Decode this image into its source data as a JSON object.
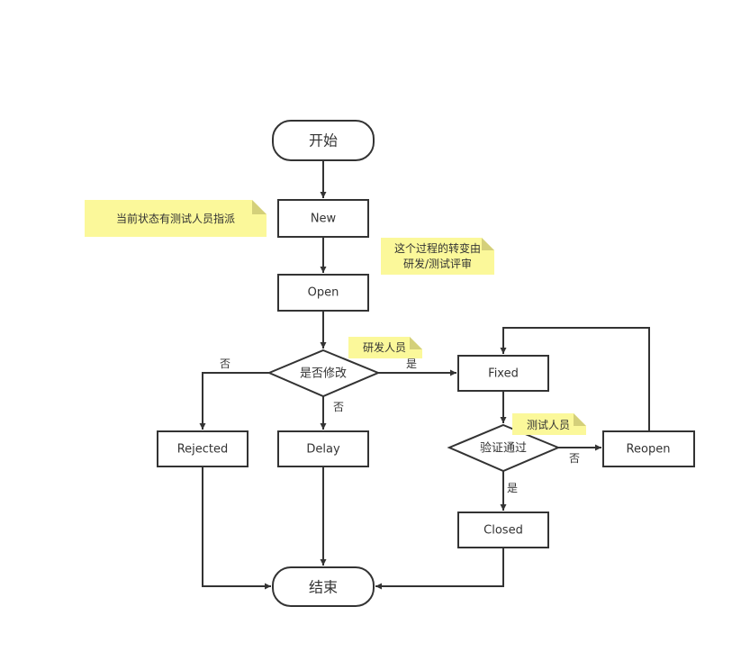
{
  "nodes": {
    "start": "开始",
    "new": "New",
    "open": "Open",
    "decision_modify": "是否修改",
    "rejected": "Rejected",
    "delay": "Delay",
    "fixed": "Fixed",
    "decision_verify": "验证通过",
    "reopen": "Reopen",
    "closed": "Closed",
    "end": "结束"
  },
  "edge_labels": {
    "modify_no_rejected": "否",
    "modify_yes_fixed": "是",
    "modify_no_delay": "否",
    "verify_no_reopen": "否",
    "verify_yes_closed": "是"
  },
  "notes": {
    "new_note": "当前状态有测试人员指派",
    "open_note_line1": "这个过程的转变由",
    "open_note_line2": "研发/测试评审",
    "dev_note": "研发人员",
    "test_note": "测试人员"
  },
  "colors": {
    "note": "#fbf89a",
    "stroke": "#333333"
  }
}
